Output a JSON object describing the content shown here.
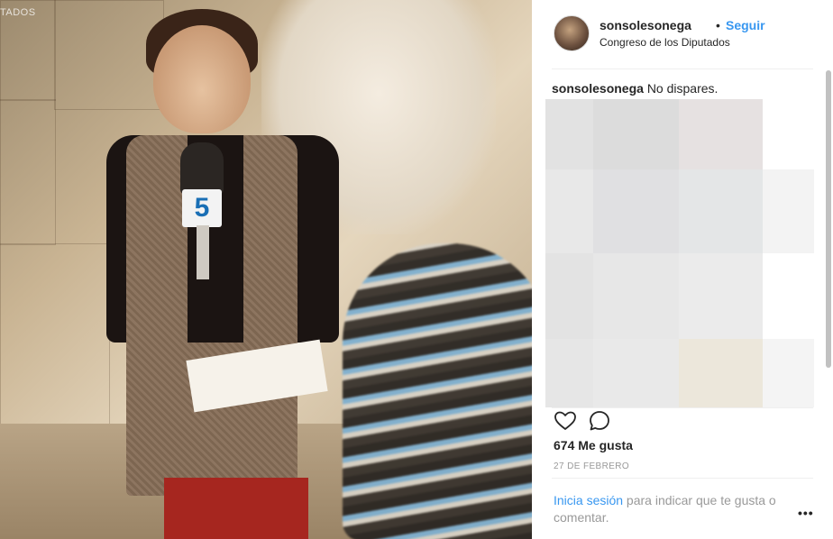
{
  "photo": {
    "wall_text": "TADOS",
    "mic_flag_logo": "5"
  },
  "post": {
    "username": "sonsolesonega",
    "separator": "•",
    "follow_label": "Seguir",
    "location": "Congreso de los Diputados",
    "caption_user": "sonsolesonega",
    "caption_text": "No dispares.",
    "likes": "674 Me gusta",
    "date": "27 DE FEBRERO",
    "login_link": "Inicia sesión",
    "login_rest": " para indicar que te gusta o comentar.",
    "more_label": "•••"
  },
  "icons": {
    "like": "heart-icon",
    "comment": "comment-icon",
    "more": "more-options-icon"
  },
  "colors": {
    "link": "#3897f0",
    "text": "#262626",
    "muted": "#999999",
    "divider": "#efefef"
  }
}
